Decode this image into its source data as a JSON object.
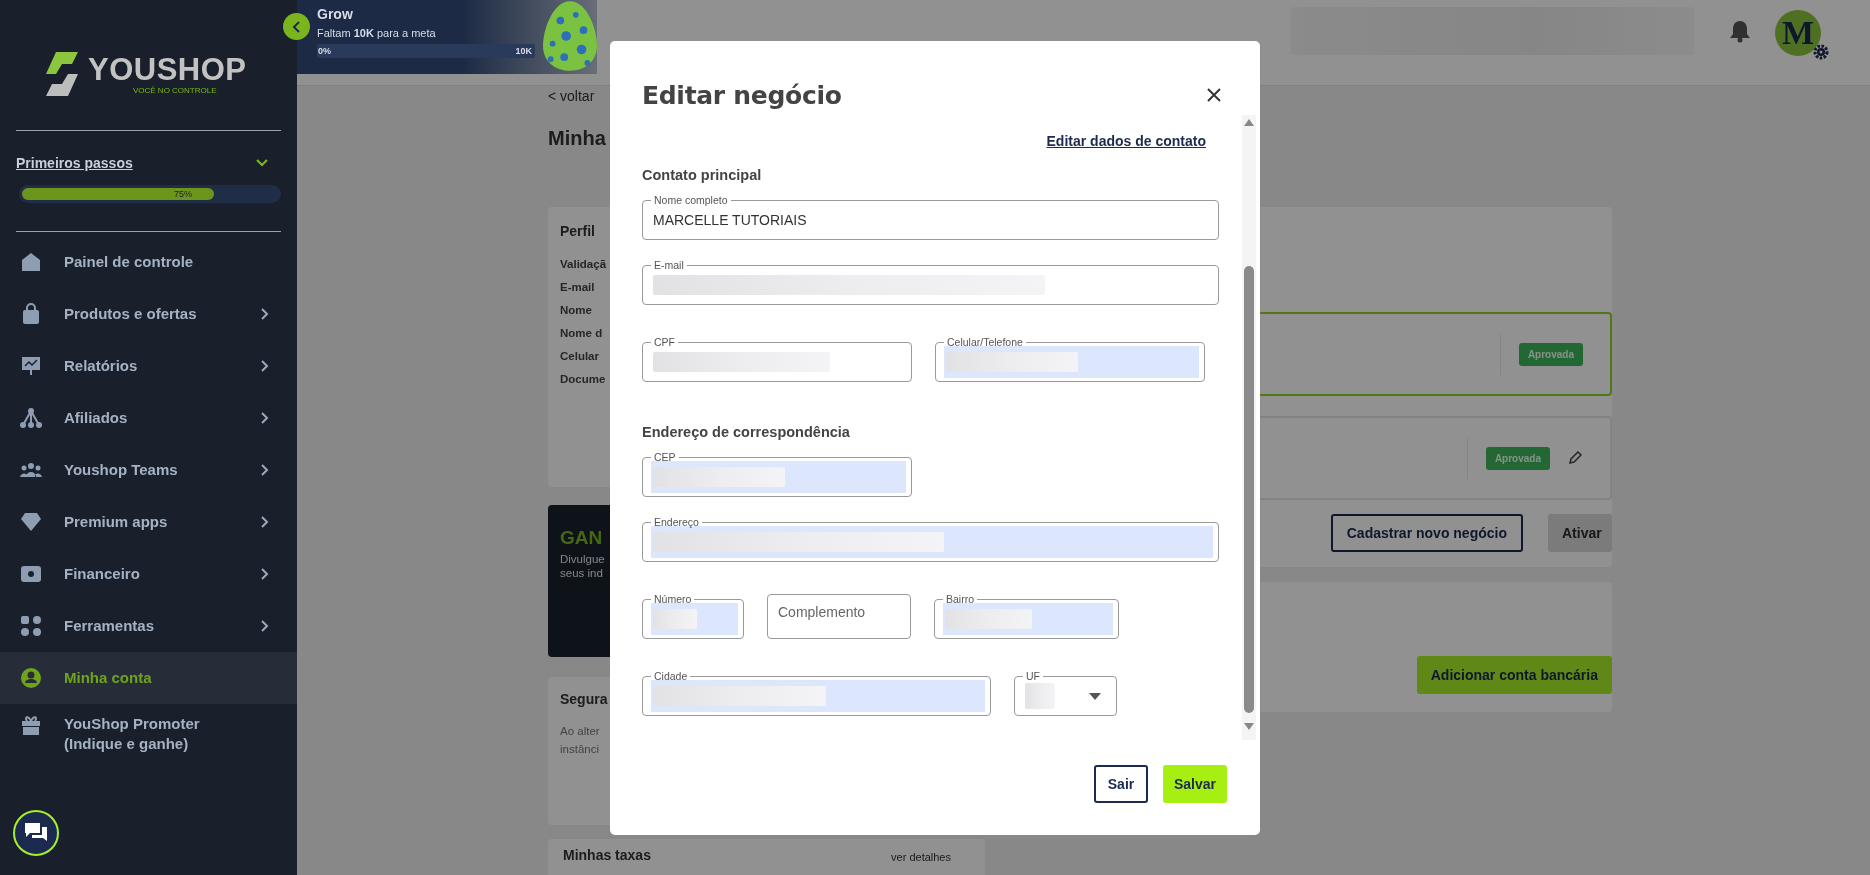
{
  "sidebar": {
    "logo": {
      "name": "YOUSHOP",
      "tagline": "VOCÊ NO CONTROLE"
    },
    "onboarding": {
      "title": "Primeiros passos",
      "expanded": true,
      "level": 0.75,
      "reading": "75%"
    },
    "items": [
      {
        "label": "Painel de controle",
        "selected": false,
        "has_submenu": false
      },
      {
        "label": "Produtos e ofertas",
        "selected": false,
        "has_submenu": true
      },
      {
        "label": "Relatórios",
        "selected": false,
        "has_submenu": true
      },
      {
        "label": "Afiliados",
        "selected": false,
        "has_submenu": true
      },
      {
        "label": "Youshop Teams",
        "selected": false,
        "has_submenu": true
      },
      {
        "label": "Premium apps",
        "selected": false,
        "has_submenu": true
      },
      {
        "label": "Financeiro",
        "selected": false,
        "has_submenu": true
      },
      {
        "label": "Ferramentas",
        "selected": false,
        "has_submenu": true
      },
      {
        "label": "Minha conta",
        "selected": true,
        "has_submenu": false
      },
      {
        "label": "YouShop Promoter (Indique e ganhe)",
        "selected": false,
        "has_submenu": false
      }
    ]
  },
  "banner": {
    "title": "Grow",
    "subtitle": "Faltam **10K** para a meta",
    "level": 0,
    "start": "0%",
    "end": "10K"
  },
  "topbar": {
    "avatar_initial": "M"
  },
  "page": {
    "back": "< voltar",
    "title": "Minha",
    "profile_card": {
      "title": "Perfil",
      "rows": [
        "Validaçã",
        "E-mail",
        "Nome",
        "Nome d",
        "Celular",
        "Docume"
      ]
    },
    "promo_card": {
      "title": "GAN",
      "lines": [
        "Divulgue",
        "seus ind"
      ]
    },
    "security_card": {
      "title": "Segura",
      "lines": [
        "Ao alter",
        "instânci"
      ]
    },
    "fees_card": {
      "title": "Minhas taxas",
      "link": "ver detalhes"
    },
    "businesses": [
      {
        "status": "Aprovada",
        "selected": true,
        "editable": false
      },
      {
        "status": "Aprovada",
        "selected": false,
        "editable": true
      }
    ],
    "business_actions": [
      {
        "label": "Cadastrar novo negócio",
        "disabled": false
      },
      {
        "label": "Ativar",
        "disabled": true
      }
    ],
    "bank_button": "Adicionar conta bancária"
  },
  "modal": {
    "title": "Editar negócio",
    "link": "Editar dados de contato",
    "sections": [
      {
        "title": "Contato principal",
        "rows": [
          [
            {
              "label": "Nome completo",
              "kind": "text",
              "value": "MARCELLE TUTORIAIS",
              "autofilled": false
            }
          ],
          [
            {
              "label": "E-mail",
              "kind": "blurred",
              "autofilled": false
            }
          ],
          [
            {
              "label": "CPF",
              "kind": "blurred",
              "autofilled": false
            },
            {
              "label": "Celular/Telefone",
              "kind": "blurred",
              "autofilled": true
            }
          ]
        ]
      },
      {
        "title": "Endereço de correspondência",
        "rows": [
          [
            {
              "label": "CEP",
              "kind": "blurred",
              "autofilled": true
            }
          ],
          [
            {
              "label": "Endereço",
              "kind": "blurred",
              "autofilled": true
            }
          ],
          [
            {
              "label": "Número",
              "kind": "blurred",
              "autofilled": true
            },
            {
              "placeholder": "Complemento",
              "kind": "empty",
              "autofilled": false
            },
            {
              "label": "Bairro",
              "kind": "blurred",
              "autofilled": true
            }
          ],
          [
            {
              "label": "Cidade",
              "kind": "blurred",
              "autofilled": true
            },
            {
              "label": "UF",
              "kind": "select",
              "autofilled": false
            }
          ]
        ]
      }
    ],
    "buttons": [
      {
        "label": "Sair",
        "kind": "outline"
      },
      {
        "label": "Salvar",
        "kind": "primary"
      }
    ]
  }
}
